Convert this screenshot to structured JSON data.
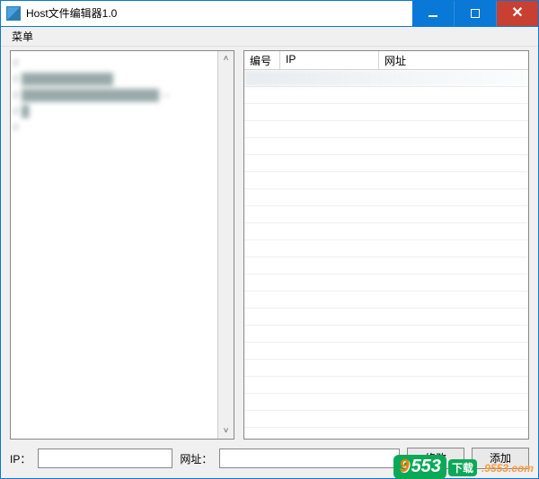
{
  "window": {
    "title": "Host文件编辑器1.0"
  },
  "menu": {
    "items": [
      {
        "label": "菜单"
      }
    ]
  },
  "table": {
    "columns": {
      "no": "编号",
      "ip": "IP",
      "url": "网址"
    }
  },
  "form": {
    "ip_label": "IP：",
    "ip_value": "",
    "url_label": "网址：",
    "url_value": "",
    "modify_label": "修改",
    "add_label": "添加"
  },
  "scroll": {
    "up": "˄",
    "down": "˅"
  },
  "watermark": {
    "d1": "9",
    "d2": "553",
    "suffix": "下载",
    "domain": ".9553.com"
  }
}
